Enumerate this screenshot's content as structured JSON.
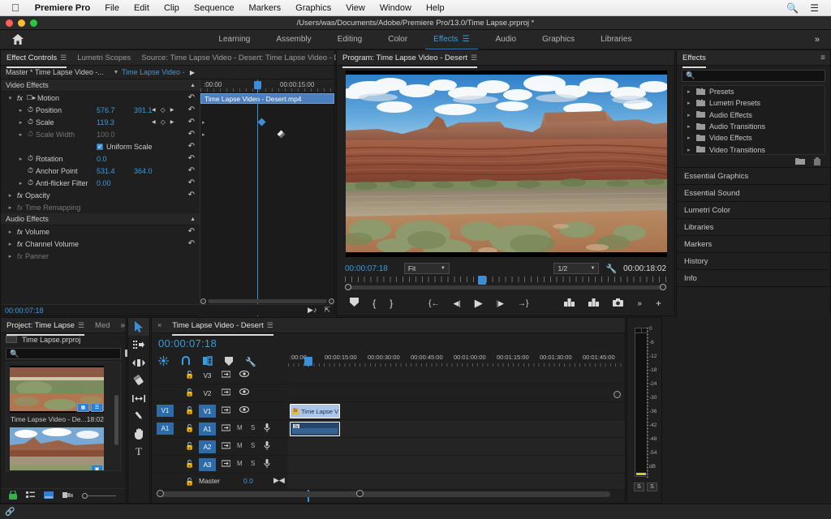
{
  "macmenu": {
    "apple": "apple-logo",
    "items": [
      "Premiere Pro",
      "File",
      "Edit",
      "Clip",
      "Sequence",
      "Markers",
      "Graphics",
      "View",
      "Window",
      "Help"
    ],
    "sysicons": [
      "search-icon",
      "list-icon"
    ]
  },
  "window": {
    "title": "/Users/was/Documents/Adobe/Premiere Pro/13.0/Time Lapse.prproj *"
  },
  "workspace": {
    "home": "home-icon",
    "tabs": [
      "Learning",
      "Assembly",
      "Editing",
      "Color",
      "Effects",
      "Audio",
      "Graphics",
      "Libraries"
    ],
    "active": "Effects",
    "more": "»"
  },
  "effect_controls": {
    "tabs": [
      {
        "label": "Effect Controls",
        "active": true,
        "hamburger": true
      },
      {
        "label": "Lumetri Scopes",
        "active": false
      },
      {
        "label": "Source: Time Lapse Video - Desert: Time Lapse Video - Deser",
        "active": false
      }
    ],
    "more": "»",
    "master_label": "Master * Time Lapse Video -...",
    "clip_label": "Time Lapse Video - Deser...",
    "sections": [
      {
        "name": "Video Effects",
        "rows": [
          {
            "label": "Motion",
            "type": "effect",
            "fx": true,
            "twirl": "⌄",
            "reset": true
          },
          {
            "label": "Position",
            "type": "param",
            "values": [
              "576.7",
              "391.1"
            ],
            "nav": true,
            "reset": true,
            "stopwatch": "on"
          },
          {
            "label": "Scale",
            "type": "param",
            "values": [
              "119.3"
            ],
            "nav": true,
            "reset": true,
            "stopwatch": "on"
          },
          {
            "label": "Scale Width",
            "type": "param",
            "values": [
              "100.0"
            ],
            "dim": true,
            "reset": true,
            "stopwatch": "off"
          },
          {
            "label": "Uniform Scale",
            "type": "checkbox",
            "checked": true,
            "reset": true
          },
          {
            "label": "Rotation",
            "type": "param",
            "values": [
              "0.0"
            ],
            "reset": true,
            "stopwatch": "off"
          },
          {
            "label": "Anchor Point",
            "type": "param",
            "values": [
              "531.4",
              "364.0"
            ],
            "reset": true,
            "stopwatch": "off",
            "noTwirl": true
          },
          {
            "label": "Anti-flicker Filter",
            "type": "param",
            "values": [
              "0.00"
            ],
            "reset": true,
            "stopwatch": "off"
          },
          {
            "label": "Opacity",
            "type": "effect",
            "fx": true,
            "reset": true
          },
          {
            "label": "Time Remapping",
            "type": "effect",
            "fx": true,
            "dim": true
          }
        ]
      },
      {
        "name": "Audio Effects",
        "rows": [
          {
            "label": "Volume",
            "type": "effect",
            "fx": true,
            "reset": true
          },
          {
            "label": "Channel Volume",
            "type": "effect",
            "fx": true,
            "reset": true
          },
          {
            "label": "Panner",
            "type": "effect",
            "fx": true,
            "dim": true
          }
        ]
      }
    ],
    "timeline": {
      "ruler_labels": [
        ":00:00",
        "00:00:15:00"
      ],
      "clip_bar_label": "Time Lapse Video - Desert.mp4",
      "keyframes": [
        {
          "row": "Position",
          "color": "blue"
        },
        {
          "row": "Scale",
          "color": "grey"
        }
      ]
    },
    "footer_timecode": "00:00:07:18",
    "footer_icons": [
      "play-audio-icon",
      "export-frame-icon"
    ]
  },
  "program_monitor": {
    "title": "Program: Time Lapse Video - Desert",
    "hamburger": "≡",
    "timecode": "00:00:07:18",
    "fit_value": "Fit",
    "quality_value": "1/2",
    "wrench": "wrench-icon",
    "duration": "00:00:18:02",
    "transport": [
      "marker-icon",
      "mark-in-icon",
      "mark-out-icon",
      "go-to-in-icon",
      "step-back-icon",
      "play-icon",
      "step-forward-icon",
      "go-to-out-icon",
      "lift-icon",
      "extract-icon",
      "export-frame-icon",
      "more-icon",
      "button-editor-icon"
    ]
  },
  "effects_panel": {
    "tab": "Effects",
    "hamburger": "≡",
    "search_placeholder": "",
    "search_value": "",
    "find_icon": "binoculars-icon",
    "items": [
      {
        "label": "Presets",
        "icon": "preset-folder-icon"
      },
      {
        "label": "Lumetri Presets",
        "icon": "preset-folder-icon"
      },
      {
        "label": "Audio Effects",
        "icon": "folder-icon"
      },
      {
        "label": "Audio Transitions",
        "icon": "folder-icon"
      },
      {
        "label": "Video Effects",
        "icon": "folder-icon"
      },
      {
        "label": "Video Transitions",
        "icon": "folder-icon"
      }
    ],
    "footer_icons": [
      "new-bin-icon",
      "delete-icon"
    ]
  },
  "collapsed_panels": [
    "Essential Graphics",
    "Essential Sound",
    "Lumetri Color",
    "Libraries",
    "Markers",
    "History",
    "Info"
  ],
  "project_panel": {
    "tabs": [
      {
        "label": "Project: Time Lapse",
        "active": true,
        "hamburger": true
      },
      {
        "label": "Med",
        "active": false
      }
    ],
    "more": "»",
    "project_name": "Time Lapse.prproj",
    "search_value": "",
    "find_icon": "find-icon",
    "items": [
      {
        "name": "Time Lapse Video - De...",
        "duration": "18:02",
        "badges": [
          "video-badge",
          "audio-badge"
        ]
      },
      {
        "name": "",
        "duration": "",
        "badges": [
          "sequence-badge"
        ]
      }
    ],
    "footer_icons": [
      "lock-icon",
      "list-view-icon",
      "icon-view-icon",
      "freeform-view-icon"
    ]
  },
  "tools": [
    {
      "name": "selection-tool",
      "glyph": "➤",
      "active": true
    },
    {
      "name": "track-select-forward-tool",
      "glyph": "",
      "active": false
    },
    {
      "name": "ripple-edit-tool",
      "glyph": "",
      "active": false
    },
    {
      "name": "razor-tool",
      "glyph": "",
      "active": false
    },
    {
      "name": "slip-tool",
      "glyph": "",
      "active": false
    },
    {
      "name": "pen-tool",
      "glyph": "",
      "active": false
    },
    {
      "name": "hand-tool",
      "glyph": "",
      "active": false
    },
    {
      "name": "type-tool",
      "glyph": "T",
      "active": false
    }
  ],
  "timeline": {
    "tab": "Time Lapse Video - Desert",
    "close": "×",
    "hamburger": "≡",
    "timecode": "00:00:07:18",
    "tool_icons": [
      "insert-overwrite-icon",
      "snap-icon",
      "linked-selection-icon",
      "marker-icon",
      "timeline-settings-icon"
    ],
    "ruler_labels": [
      ":00:00",
      "00:00:15:00",
      "00:00:30:00",
      "00:00:45:00",
      "00:01:00:00",
      "00:01:15:00",
      "00:01:30:00",
      "00:01:45:00"
    ],
    "tracks": [
      {
        "name": "V3",
        "type": "video",
        "targeted": false,
        "armed": false
      },
      {
        "name": "V2",
        "type": "video",
        "targeted": false,
        "armed": false
      },
      {
        "name": "V1",
        "type": "video",
        "targeted": true,
        "armed": true,
        "source": "V1",
        "clip": {
          "label": "Time Lapse V"
        }
      },
      {
        "name": "A1",
        "type": "audio",
        "targeted": true,
        "armed": true,
        "source": "A1",
        "mute": "M",
        "solo": "S",
        "clip": {
          "label": ""
        }
      },
      {
        "name": "A2",
        "type": "audio",
        "targeted": true,
        "armed": false,
        "mute": "M",
        "solo": "S"
      },
      {
        "name": "A3",
        "type": "audio",
        "targeted": true,
        "armed": false,
        "mute": "M",
        "solo": "S"
      }
    ],
    "master": {
      "label": "Master",
      "value": "0.0"
    }
  },
  "audio_meters": {
    "scale": [
      "0",
      "-6",
      "-12",
      "-18",
      "-24",
      "-30",
      "-36",
      "-42",
      "-48",
      "-54",
      "dB"
    ],
    "solo_buttons": [
      "S",
      "S"
    ]
  },
  "status_bar": {
    "icon": "link-icon"
  },
  "colors": {
    "accent_blue": "#3b9bdc",
    "playhead_blue": "#3b8fd8",
    "panel_bg": "#1f1f1f",
    "tab_bg": "#262626",
    "work_area_yellow": "#d8dd3a",
    "clip_video": "#aec5e8",
    "clip_audio": "#26456b"
  }
}
